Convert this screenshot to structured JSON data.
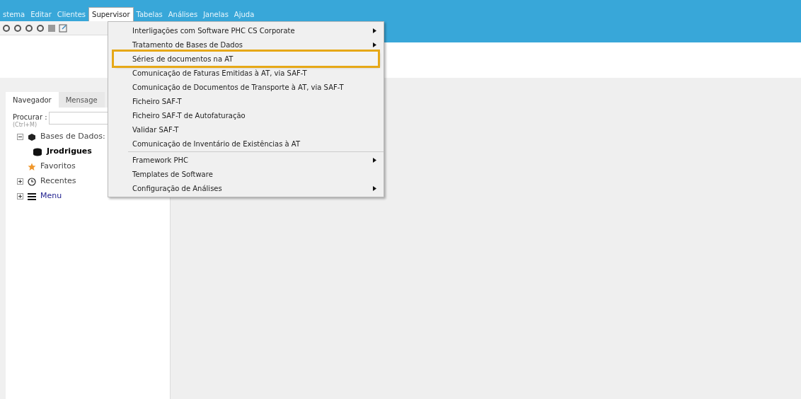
{
  "menu_bar": [
    {
      "label": "stema",
      "selected": false
    },
    {
      "label": "Editar",
      "selected": false
    },
    {
      "label": "Clientes",
      "selected": false
    },
    {
      "label": "Supervisor",
      "selected": true
    },
    {
      "label": "Tabelas",
      "selected": false
    },
    {
      "label": "Análises",
      "selected": false
    },
    {
      "label": "Janelas",
      "selected": false
    },
    {
      "label": "Ajuda",
      "selected": false
    }
  ],
  "dropdown_groups": [
    {
      "items": [
        {
          "label": "Interligações com Software PHC CS Corporate",
          "kind": "submenu",
          "highlighted": false
        },
        {
          "label": "Tratamento de Bases de Dados",
          "kind": "submenu",
          "highlighted": false
        },
        {
          "label": "Séries de documentos na AT",
          "kind": "command",
          "highlighted": true
        },
        {
          "label": "Comunicação de Faturas Emitidas à AT, via SAF-T",
          "kind": "command",
          "highlighted": false
        },
        {
          "label": "Comunicação de Documentos de Transporte à AT, via SAF-T",
          "kind": "command",
          "highlighted": false
        },
        {
          "label": "Ficheiro SAF-T",
          "kind": "command",
          "highlighted": false
        },
        {
          "label": "Ficheiro SAF-T de Autofaturação",
          "kind": "command",
          "highlighted": false
        },
        {
          "label": "Validar SAF-T",
          "kind": "command",
          "highlighted": false
        },
        {
          "label": "Comunicação de Inventário de Existências à AT",
          "kind": "command",
          "highlighted": false
        }
      ]
    },
    {
      "items": [
        {
          "label": "Framework PHC",
          "kind": "submenu",
          "highlighted": false
        },
        {
          "label": "Templates de Software",
          "kind": "command",
          "highlighted": false
        },
        {
          "label": "Configuração de Análises",
          "kind": "submenu",
          "highlighted": false
        }
      ]
    }
  ],
  "panel_tabs": [
    {
      "label": "Navegador",
      "selected": true
    },
    {
      "label": "Mensage",
      "selected": false
    }
  ],
  "search": {
    "label": "Procurar :",
    "hint": "(Ctrl+M)"
  },
  "tree": [
    {
      "label": "Bases de Dados:",
      "kind": "databases",
      "expanded": true,
      "children": [
        {
          "label": "Jrodrigues",
          "kind": "connection"
        }
      ]
    },
    {
      "label": "Favoritos",
      "kind": "favorites"
    },
    {
      "label": "Recentes",
      "kind": "recent",
      "expanded": false
    },
    {
      "label": "Menu",
      "kind": "menu",
      "expanded": false
    }
  ]
}
